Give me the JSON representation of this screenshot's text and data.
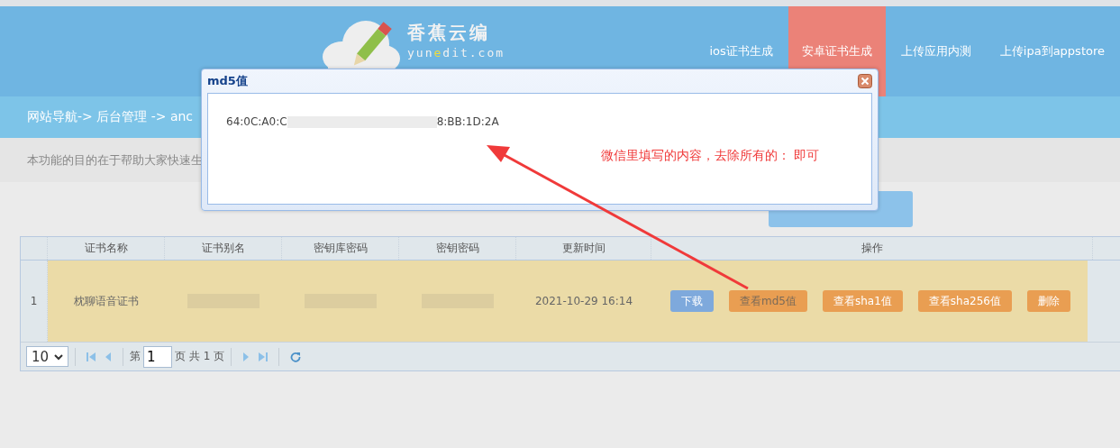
{
  "logo": {
    "title": "香蕉云编",
    "domain_start": "yun",
    "domain_highlight": "e",
    "domain_end": "dit.com"
  },
  "nav": [
    {
      "label": "ios证书生成",
      "selected": false
    },
    {
      "label": "安卓证书生成",
      "selected": true
    },
    {
      "label": "上传应用内测",
      "selected": false
    },
    {
      "label": "上传ipa到appstore",
      "selected": false
    }
  ],
  "breadcrumb": "网站导航-> 后台管理 -> anc",
  "intro": "本功能的目的在于帮助大家快速生",
  "table": {
    "columns": [
      "证书名称",
      "证书别名",
      "密钥库密码",
      "密钥密码",
      "更新时间",
      "操作"
    ],
    "rows": [
      {
        "index": "1",
        "name": "枕聊语音证书",
        "alias_redacted": true,
        "keystore_password_redacted": true,
        "key_password_redacted": true,
        "updated": "2021-10-29 16:14",
        "selected": true,
        "actions": [
          {
            "label": "下载",
            "kind": "primary",
            "hovered": false
          },
          {
            "label": "查看md5值",
            "kind": "warning",
            "hovered": true
          },
          {
            "label": "查看sha1值",
            "kind": "warning",
            "hovered": false
          },
          {
            "label": "查看sha256值",
            "kind": "warning",
            "hovered": false
          },
          {
            "label": "删除",
            "kind": "warning",
            "hovered": false
          }
        ]
      }
    ]
  },
  "pager": {
    "page_size": "10",
    "page_prefix": "第",
    "page": "1",
    "page_suffix": "页 共 1 页"
  },
  "dialog": {
    "title": "md5值",
    "value_start": "64:0C:A0:C",
    "value_end": "8:BB:1D:2A",
    "annotation": "微信里填写的内容，去除所有的： 即可"
  }
}
